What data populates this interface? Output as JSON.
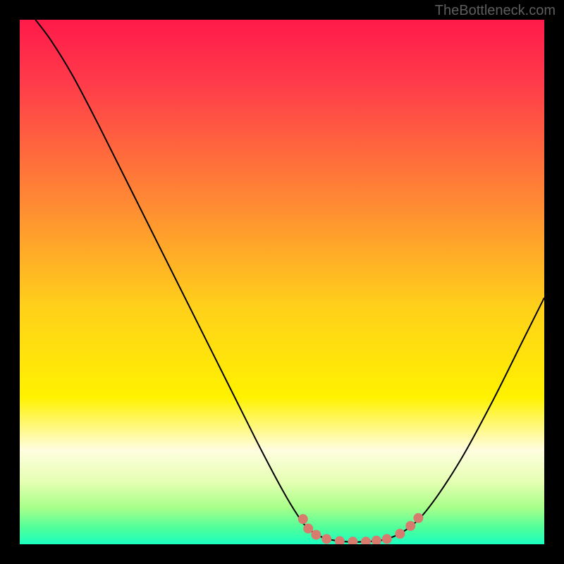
{
  "watermark": "TheBottleneck.com",
  "chart_data": {
    "type": "line",
    "title": "",
    "xlabel": "",
    "ylabel": "",
    "xlim": [
      0,
      100
    ],
    "ylim": [
      0,
      100
    ],
    "background_gradient_stops": [
      {
        "offset": 0,
        "color": "#ff1a4a"
      },
      {
        "offset": 12,
        "color": "#ff3b4a"
      },
      {
        "offset": 35,
        "color": "#ff8a33"
      },
      {
        "offset": 55,
        "color": "#ffd11a"
      },
      {
        "offset": 72,
        "color": "#fff200"
      },
      {
        "offset": 82,
        "color": "#fffde0"
      },
      {
        "offset": 88,
        "color": "#e6ffb3"
      },
      {
        "offset": 93,
        "color": "#a8ff8a"
      },
      {
        "offset": 97,
        "color": "#4dff9c"
      },
      {
        "offset": 100,
        "color": "#1affc0"
      }
    ],
    "series": [
      {
        "name": "bottleneck-curve",
        "color": "#000000",
        "stroke_width": 2,
        "points": [
          {
            "x": 3.0,
            "y": 100.0
          },
          {
            "x": 6.0,
            "y": 96.0
          },
          {
            "x": 10.0,
            "y": 89.5
          },
          {
            "x": 15.0,
            "y": 80.0
          },
          {
            "x": 22.0,
            "y": 66.0
          },
          {
            "x": 30.0,
            "y": 50.0
          },
          {
            "x": 38.0,
            "y": 34.0
          },
          {
            "x": 45.0,
            "y": 20.0
          },
          {
            "x": 50.0,
            "y": 10.5
          },
          {
            "x": 53.0,
            "y": 5.5
          },
          {
            "x": 55.0,
            "y": 3.0
          },
          {
            "x": 58.0,
            "y": 1.2
          },
          {
            "x": 62.0,
            "y": 0.5
          },
          {
            "x": 66.0,
            "y": 0.5
          },
          {
            "x": 70.0,
            "y": 1.0
          },
          {
            "x": 74.0,
            "y": 3.0
          },
          {
            "x": 78.0,
            "y": 7.0
          },
          {
            "x": 84.0,
            "y": 16.0
          },
          {
            "x": 90.0,
            "y": 27.0
          },
          {
            "x": 96.0,
            "y": 39.0
          },
          {
            "x": 100.0,
            "y": 47.0
          }
        ]
      },
      {
        "name": "highlight-dots",
        "color": "#d87b6f",
        "marker_radius": 7,
        "points": [
          {
            "x": 54.0,
            "y": 4.8
          },
          {
            "x": 55.0,
            "y": 3.0
          },
          {
            "x": 56.5,
            "y": 1.8
          },
          {
            "x": 58.5,
            "y": 1.0
          },
          {
            "x": 61.0,
            "y": 0.6
          },
          {
            "x": 63.5,
            "y": 0.5
          },
          {
            "x": 66.0,
            "y": 0.5
          },
          {
            "x": 68.0,
            "y": 0.7
          },
          {
            "x": 70.0,
            "y": 1.0
          },
          {
            "x": 72.5,
            "y": 2.0
          },
          {
            "x": 74.5,
            "y": 3.5
          },
          {
            "x": 76.0,
            "y": 5.0
          }
        ]
      }
    ]
  }
}
